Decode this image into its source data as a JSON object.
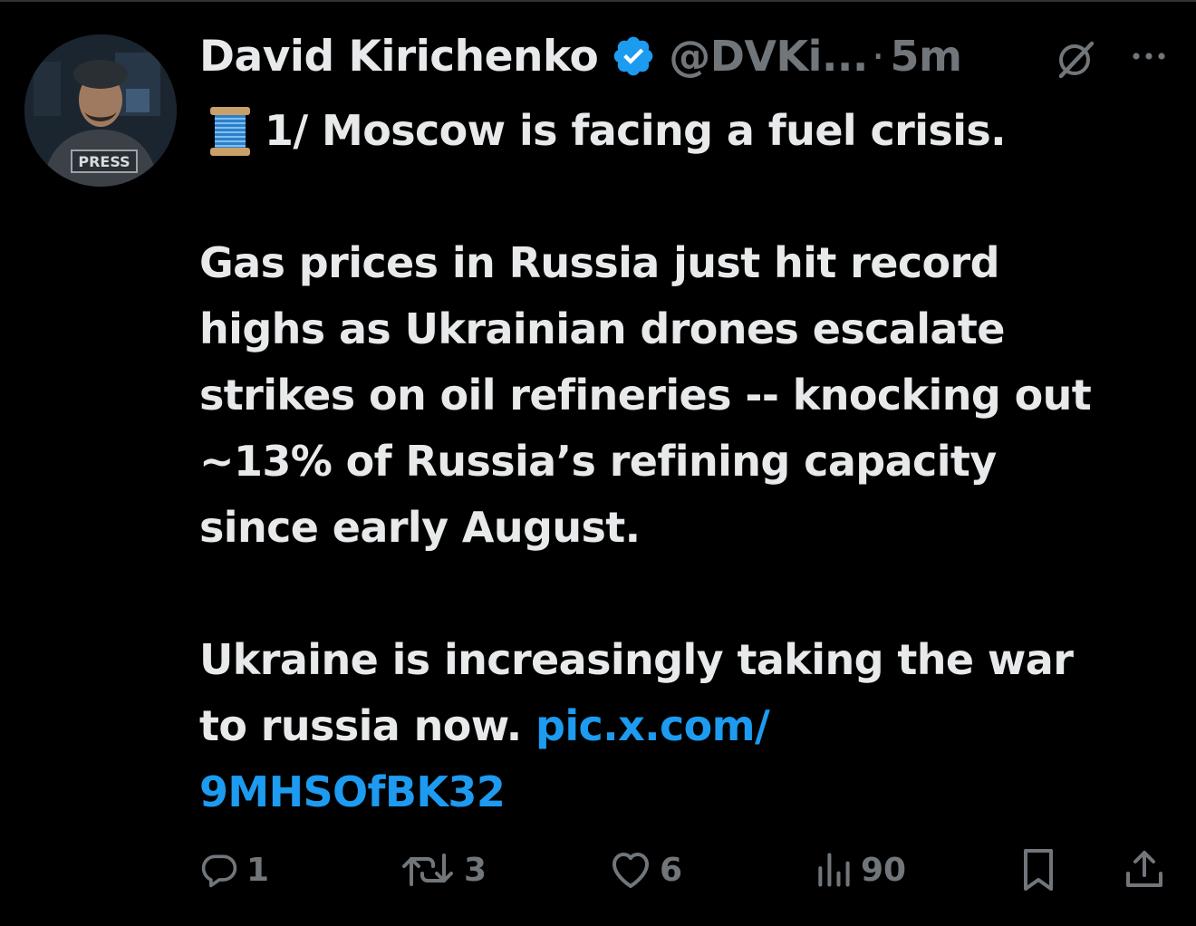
{
  "tweet": {
    "author": {
      "name": "David Kirichenko",
      "handle": "@DVKi...",
      "verified": true,
      "verified_color": "#1d9bf0",
      "avatar_badge_text": "PRESS"
    },
    "separator": "·",
    "time": "5m",
    "icons": {
      "grok": "grok-icon",
      "more": "more-dots-icon",
      "thread": "spool-emoji-icon"
    },
    "text": {
      "line1": "1/ Moscow is facing a fuel crisis.",
      "para2_line1": "Gas prices in Russia just hit record",
      "para2_line2": "highs as Ukrainian drones escalate",
      "para2_line3": "strikes on oil refineries -- knocking out",
      "para2_line4": "~13% of Russia’s refining capacity",
      "para2_line5": "since early August.",
      "para3_line1": "Ukraine is increasingly taking the war",
      "para3_line2_text": "to russia now. ",
      "link_part1": "pic.x.com/",
      "link_part2": "9MHSOfBK32"
    },
    "link_color": "#1d9bf0",
    "actions": {
      "replies": "1",
      "reposts": "3",
      "likes": "6",
      "views": "90"
    },
    "colors": {
      "background": "#000000",
      "primary_text": "#e7e9ea",
      "secondary_text": "#71767b"
    }
  }
}
